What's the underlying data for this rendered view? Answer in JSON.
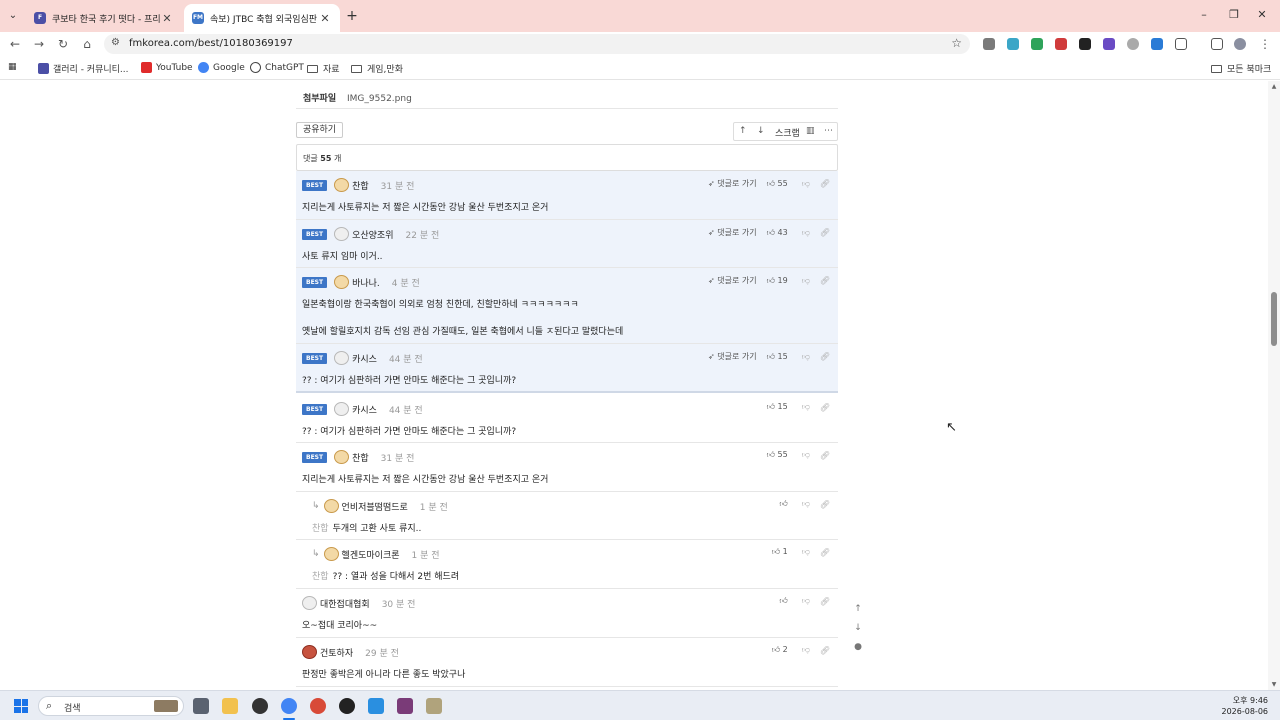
{
  "browser": {
    "tabs": [
      {
        "title": "쿠보타 한국 후기 떳다 - 프리미",
        "favicon": "fmkorea-icon",
        "active": false
      },
      {
        "title": "속보) JTBC 축협 외국임심판 진",
        "favicon": "fmkorea-icon",
        "active": true
      }
    ],
    "new_tab": "+",
    "url": "fmkorea.com/best/10180369197",
    "bookmarks": [
      {
        "label": "갤러리 - 커뮤니티...",
        "icon": "gallery-icon"
      },
      {
        "label": "YouTube",
        "icon": "youtube-icon"
      },
      {
        "label": "Google",
        "icon": "google-icon"
      },
      {
        "label": "ChatGPT",
        "icon": "chatgpt-icon"
      },
      {
        "label": "자료",
        "icon": "folder-icon"
      },
      {
        "label": "게임,만화",
        "icon": "folder-icon"
      }
    ],
    "all_bookmarks": "모든 북마크"
  },
  "post": {
    "attachment_label": "첨부파일",
    "attachment_file": "IMG_9552.png",
    "share_label": "공유하기",
    "scrap_label": "스크랩",
    "comment_count_label": "댓글",
    "comment_count": "55",
    "comment_count_unit": "개"
  },
  "comments": [
    {
      "best": true,
      "nick": "찬합",
      "time": "31 분 전",
      "goto": "댓글로 가기",
      "likes": "55",
      "text": "지리는게 사토류지는 저 짧은 시간동안 강남 울산 두번조지고 온거",
      "avatar": "dog"
    },
    {
      "best": true,
      "nick": "오산양조위",
      "time": "22 분 전",
      "goto": "댓글로 가기",
      "likes": "43",
      "text": "사토 류지 임마 이거..",
      "avatar": "cat"
    },
    {
      "best": true,
      "nick": "바나나.",
      "time": "4 분 전",
      "goto": "댓글로 가기",
      "likes": "19",
      "text": "일본축협이랑 한국축협이 의외로 엄청 친한데, 친할만하네 ㅋㅋㅋㅋㅋㅋㅋ",
      "text2": "옛날에 할릴호지치 감독 선임 관심 가질때도, 일본 축협에서 니들 ㅈ된다고 말렸다는데",
      "avatar": "dog"
    },
    {
      "best": true,
      "nick": "카시스",
      "time": "44 분 전",
      "goto": "댓글로 가기",
      "likes": "15",
      "text": "?? : 여기가 심판하러 가면 안마도 해준다는 그 곳입니까?",
      "avatar": "cat"
    },
    {
      "best": true,
      "nick": "카시스",
      "time": "44 분 전",
      "likes": "15",
      "text": "?? : 여기가 심판하러 가면 안마도 해준다는 그 곳입니까?",
      "avatar": "cat"
    },
    {
      "best": true,
      "nick": "찬합",
      "time": "31 분 전",
      "likes": "55",
      "text": "지리는게 사토류지는 저 짧은 시간동안 강남 울산 두번조지고 온거",
      "avatar": "dog"
    },
    {
      "reply": true,
      "nick": "언비저블떰떰드로",
      "time": "1 분 전",
      "likes": "",
      "quote": "찬합",
      "text": "두개의 고환 사토 류지..",
      "avatar": "dog"
    },
    {
      "reply": true,
      "nick": "헬겐도마이크론",
      "time": "1 분 전",
      "likes": "1",
      "quote": "찬합",
      "text": "?? : 열과 성을 다해서 2번 해드려",
      "avatar": "dog"
    },
    {
      "nick": "대한접대협회",
      "time": "30 분 전",
      "likes": "",
      "text": "오~접대 코리아~~",
      "avatar": "cat"
    },
    {
      "nick": "건토하자",
      "time": "29 분 전",
      "likes": "2",
      "text": "판정만 좋박은게 아니라 다른 좋도 박았구나",
      "avatar": "red"
    }
  ],
  "taskbar": {
    "search_placeholder": "검색",
    "time": "오후 9:46",
    "date": "2026-08-06"
  },
  "colors": {
    "tabstrip": "#f9d9d6",
    "best_badge": "#3d76c7",
    "best_row": "#eef3fb"
  }
}
